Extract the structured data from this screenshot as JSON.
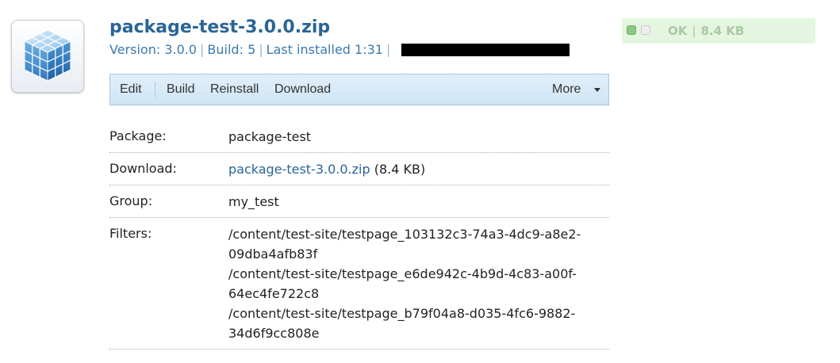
{
  "package": {
    "title": "package-test-3.0.0.zip",
    "version_label": "Version: 3.0.0",
    "build_label": "Build: 5",
    "installed_label": "Last installed 1:31",
    "separator": "|"
  },
  "status": {
    "state": "OK",
    "size": "8.4 KB",
    "separator": "|",
    "colors": {
      "ok_green": "#8cc784",
      "background": "#e4f6df"
    }
  },
  "toolbar": {
    "edit": "Edit",
    "build": "Build",
    "reinstall": "Reinstall",
    "download": "Download",
    "more": "More"
  },
  "details": {
    "package_label": "Package:",
    "package_value": "package-test",
    "download_label": "Download:",
    "download_link": "package-test-3.0.0.zip",
    "download_size": "(8.4 KB)",
    "group_label": "Group:",
    "group_value": "my_test",
    "filters_label": "Filters:",
    "filters": [
      "/content/test-site/testpage_103132c3-74a3-4dc9-a8e2-",
      "09dba4afb83f",
      "/content/test-site/testpage_e6de942c-4b9d-4c83-a00f-",
      "64ec4fe722c8",
      "/content/test-site/testpage_b79f04a8-d035-4fc6-9882-",
      "34d6f9cc808e"
    ]
  },
  "icons": {
    "package": "package-cube-icon",
    "status_ok": "status-ok-icon",
    "status_idle": "status-idle-icon",
    "more_caret": "chevron-down-icon"
  },
  "theme": {
    "link_color": "#2a6496",
    "toolbar_border": "#a8c8e2"
  }
}
